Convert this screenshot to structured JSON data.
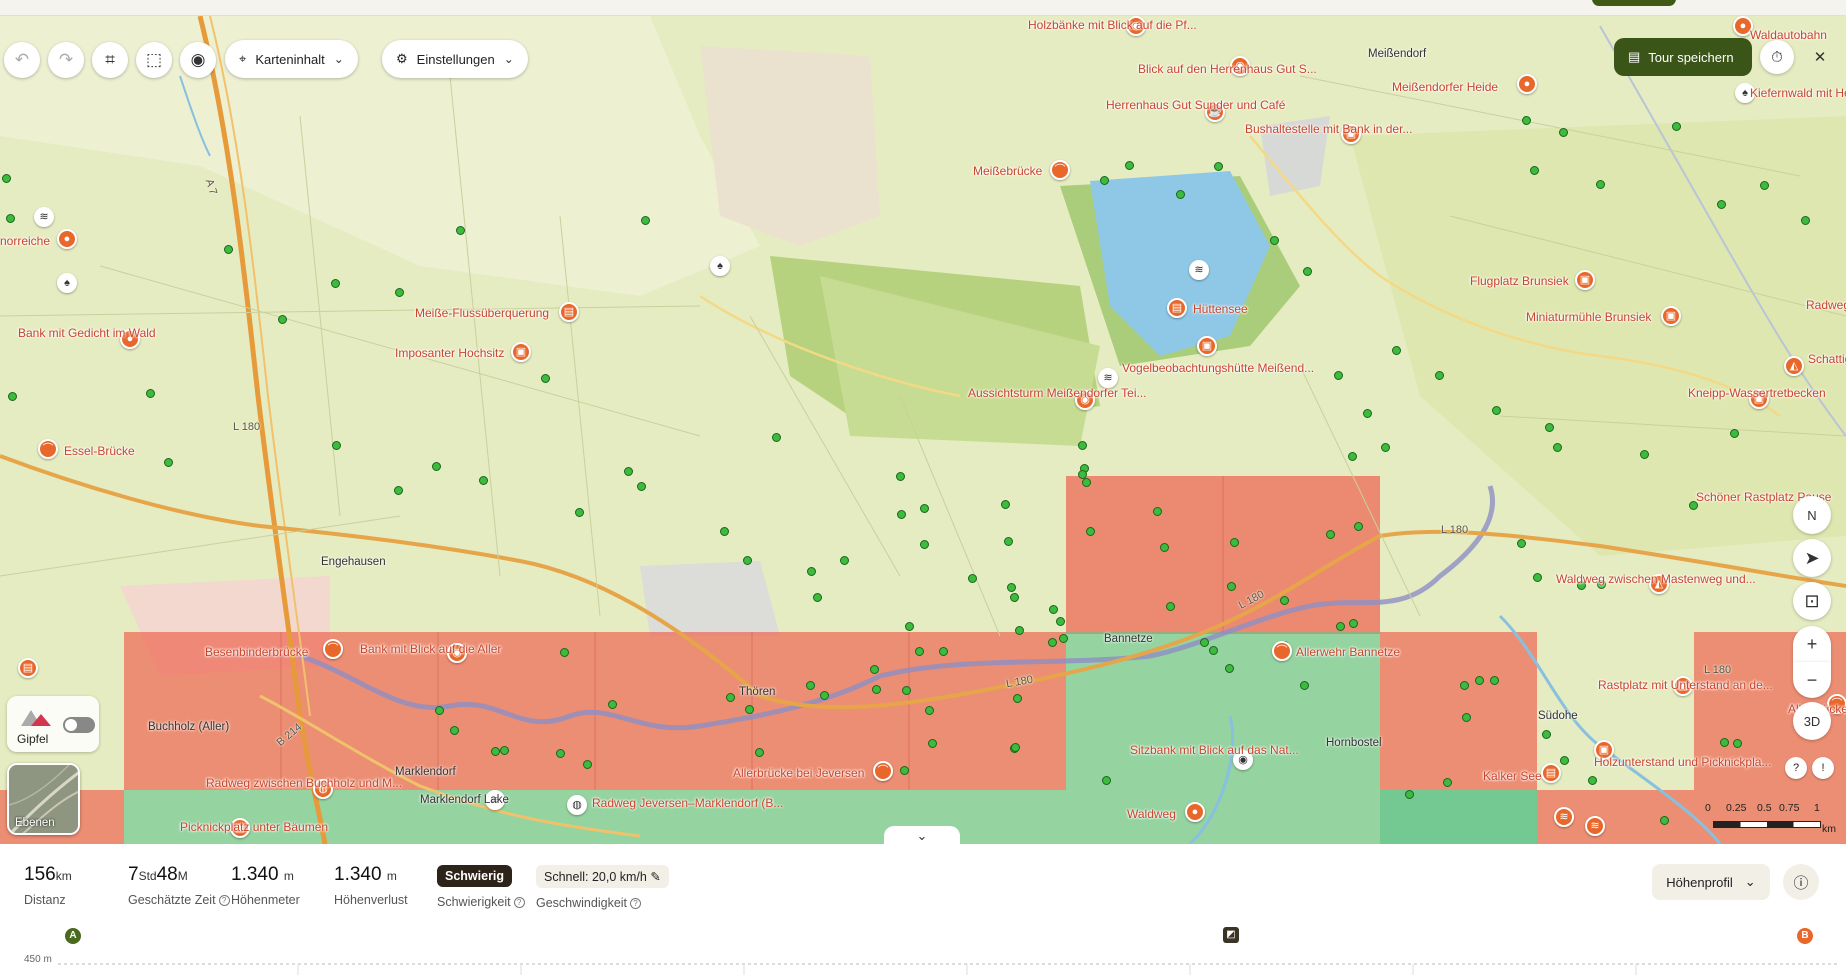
{
  "toolbar": {
    "map_content_label": "Karteninhalt",
    "settings_label": "Einstellungen",
    "save_tour_label": "Tour speichern"
  },
  "map": {
    "poi_labels": [
      "Holzbänke mit Blick auf die Pf...",
      "Blick auf den Herrenhaus Gut S...",
      "Herrenhaus Gut Sunder und Café",
      "Bushaltestelle mit Bank in der...",
      "Meißendorfer Heide",
      "Waldautobahn",
      "Kiefernwald mit Heidelbeeren",
      "Meißebrücke",
      "Hüttensee",
      "Flugplatz Brunsiek",
      "Miniaturmühle Brunsiek",
      "Radweg z",
      "Schattiger der Lü",
      "Meiße-Flussüberquerung",
      "Imposanter Hochsitz",
      "Bank mit Gedicht im Wald",
      "norreiche",
      "Vogelbeobachtungshütte Meißend...",
      "Aussichtsturm Meißendorfer Tei...",
      "Kneipp-Wassertretbecken",
      "Essel-Brücke",
      "Schöner Rastplatz Pause",
      "Waldweg zwischen Mastenweg und...",
      "Besenbinderbrücke",
      "Bank mit Blick auf die Aller",
      "Allerwehr Bannetze",
      "Rastplatz mit Unterstand an de...",
      "Allerbrücke Wi",
      "Radweg zwischen Buchholz und M...",
      "Allerbrücke bei Jeversen",
      "Sitzbank mit Blick auf das Nat...",
      "Kalker See",
      "Holzunterstand und Picknickpla...",
      "Picknickplatz unter Bäumen",
      "Radweg Jeversen–Marklendorf (B...",
      "Waldweg"
    ],
    "towns": [
      "Meißendorf",
      "Engehausen",
      "Thören",
      "Bannetze",
      "Buchholz (Aller)",
      "Marklendorf",
      "Hornbostel",
      "Südohe",
      "Marklendorf Lake"
    ],
    "roads": [
      "L 180",
      "L 180",
      "L 180",
      "L 180",
      "L 180",
      "B 214",
      "A 7"
    ],
    "compass_label": "N",
    "threed_label": "3D"
  },
  "overlay": {
    "gipfel_label": "Gipfel",
    "ebenen_label": "Ebenen"
  },
  "scale": {
    "ticks": [
      "0",
      "0.25",
      "0.5",
      "0.75",
      "1"
    ],
    "unit": "km"
  },
  "stats": {
    "distance": {
      "value": "156",
      "unit": "km",
      "label": "Distanz"
    },
    "time": {
      "h": "7",
      "h_unit": "Std",
      "m": "48",
      "m_unit": "M",
      "label": "Geschätzte Zeit"
    },
    "ascent": {
      "value": "1.340",
      "unit": "m",
      "label": "Höhenmeter"
    },
    "descent": {
      "value": "1.340",
      "unit": "m",
      "label": "Höhenverlust"
    },
    "difficulty": {
      "value": "Schwierig",
      "label": "Schwierigkeit"
    },
    "speed": {
      "value": "Schnell: 20,0 km/h",
      "label": "Geschwindigkeit"
    }
  },
  "profile": {
    "select_label": "Höhenprofil",
    "start_marker": "A",
    "end_marker": "B",
    "elevation_label": "450 m"
  },
  "colors": {
    "brand_dark": "#3b5417",
    "poi_orange": "#e8672a",
    "overlay_red": "#ee6a55",
    "overlay_green": "#5fc38a",
    "water_blue": "#8fc8e6",
    "trail_dot": "#3dbb3d"
  },
  "icons": {
    "undo": "undo-icon",
    "redo": "redo-icon",
    "crop": "crop-icon",
    "select": "lasso-select-icon",
    "eye": "eye-icon",
    "pin": "map-pin-icon",
    "gear": "gear-icon",
    "save": "save-icon",
    "timer": "stopwatch-icon",
    "close": "close-icon"
  }
}
